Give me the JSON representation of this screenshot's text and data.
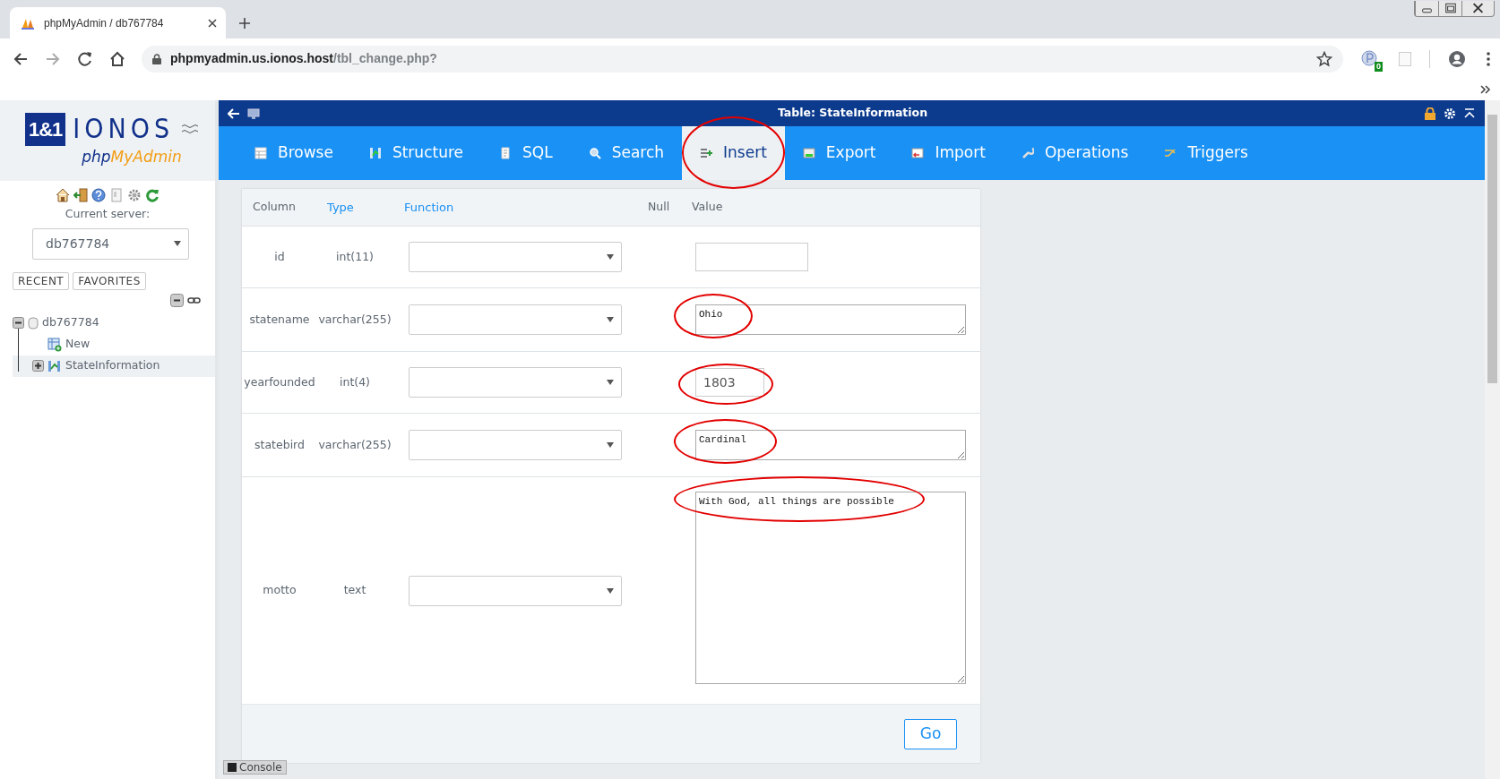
{
  "browser": {
    "tab_title": "phpMyAdmin / db767784",
    "url_host": "phpmyadmin.us.ionos.host",
    "url_path": "/tbl_change.php?",
    "extension_badge": "0"
  },
  "sidebar": {
    "logo": {
      "badge": "1&1",
      "brand": "IONOS",
      "product_prefix": "php",
      "product_suffix": "MyAdmin"
    },
    "current_server_label": "Current server:",
    "server_select": "db767784",
    "buttons": [
      "RECENT",
      "FAVORITES"
    ],
    "tree": [
      {
        "label": "db767784",
        "expanded": true,
        "selected": false,
        "children": [
          {
            "label": "New",
            "kind": "new",
            "selected": false
          },
          {
            "label": "StateInformation",
            "kind": "table",
            "expanded": false,
            "selected": true
          }
        ]
      }
    ]
  },
  "topbar": {
    "title": "Table: StateInformation"
  },
  "tabs": [
    {
      "label": "Browse",
      "selected": false,
      "circled": false
    },
    {
      "label": "Structure",
      "selected": false,
      "circled": false
    },
    {
      "label": "SQL",
      "selected": false,
      "circled": false
    },
    {
      "label": "Search",
      "selected": false,
      "circled": false
    },
    {
      "label": "Insert",
      "selected": true,
      "circled": true
    },
    {
      "label": "Export",
      "selected": false,
      "circled": false
    },
    {
      "label": "Import",
      "selected": false,
      "circled": false
    },
    {
      "label": "Operations",
      "selected": false,
      "circled": false
    },
    {
      "label": "Triggers",
      "selected": false,
      "circled": false
    }
  ],
  "form": {
    "headers": [
      {
        "label": "Column",
        "link": false
      },
      {
        "label": "Type",
        "link": true
      },
      {
        "label": "Function",
        "link": true
      },
      {
        "label": "Null",
        "link": false
      },
      {
        "label": "Value",
        "link": false
      }
    ],
    "rows": [
      {
        "column": "id",
        "type": "int(11)",
        "kind": "input",
        "value": "",
        "circled": false
      },
      {
        "column": "statename",
        "type": "varchar(255)",
        "kind": "textarea",
        "value": "Ohio",
        "circled": true
      },
      {
        "column": "yearfounded",
        "type": "int(4)",
        "kind": "short",
        "value": "1803",
        "circled": true
      },
      {
        "column": "statebird",
        "type": "varchar(255)",
        "kind": "textarea",
        "value": "Cardinal",
        "circled": true
      },
      {
        "column": "motto",
        "type": "text",
        "kind": "large",
        "value": "With God, all things are possible",
        "circled": true
      }
    ],
    "submit": "Go"
  },
  "console": "Console"
}
